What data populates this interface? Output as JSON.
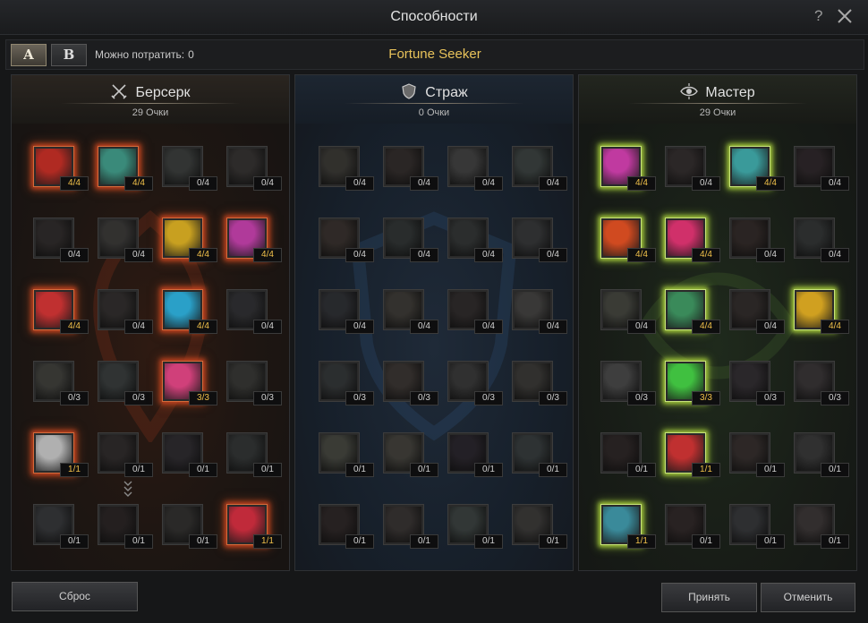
{
  "window": {
    "title": "Способности"
  },
  "toolbar": {
    "preset_a": "A",
    "preset_b": "B",
    "spend_label": "Можно потратить:",
    "spend_value": "0",
    "build_name": "Fortune Seeker"
  },
  "colors": {
    "gold": "#f0c04a",
    "red_glow": "#c0401e",
    "green_glow": "#a5c93c"
  },
  "columns": [
    {
      "name": "Берсерк",
      "icon": "crossed-swords-icon",
      "points": "29 Очки",
      "skills": [
        {
          "level": "4/4",
          "glow": "red",
          "hue": "#b02a22"
        },
        {
          "level": "4/4",
          "glow": "red",
          "hue": "#3a8a7a"
        },
        {
          "level": "0/4",
          "glow": "none",
          "hue": "#5a7a6a"
        },
        {
          "level": "0/4",
          "glow": "none",
          "hue": "#7a5a4a"
        },
        {
          "level": "0/4",
          "glow": "none",
          "hue": "#7a4a44"
        },
        {
          "level": "0/4",
          "glow": "none",
          "hue": "#7a6a5a"
        },
        {
          "level": "4/4",
          "glow": "red",
          "hue": "#c8a020"
        },
        {
          "level": "4/4",
          "glow": "red",
          "hue": "#b03a9a"
        },
        {
          "level": "4/4",
          "glow": "red",
          "hue": "#c03030"
        },
        {
          "level": "0/4",
          "glow": "none",
          "hue": "#7a5048"
        },
        {
          "level": "4/4",
          "glow": "red",
          "hue": "#2aa0c8"
        },
        {
          "level": "0/4",
          "glow": "none",
          "hue": "#5a5a7a"
        },
        {
          "level": "0/3",
          "glow": "none",
          "hue": "#7a7a4a"
        },
        {
          "level": "0/3",
          "glow": "none",
          "hue": "#4a7a7a"
        },
        {
          "level": "3/3",
          "glow": "red",
          "hue": "#d0407a"
        },
        {
          "level": "0/3",
          "glow": "none",
          "hue": "#6a6a4a"
        },
        {
          "level": "1/1",
          "glow": "red",
          "hue": "#b0b0b0"
        },
        {
          "level": "0/1",
          "glow": "none",
          "hue": "#7a4a4a"
        },
        {
          "level": "0/1",
          "glow": "none",
          "hue": "#6a4a7a"
        },
        {
          "level": "0/1",
          "glow": "none",
          "hue": "#4a6a6a"
        },
        {
          "level": "0/1",
          "glow": "none",
          "hue": "#5a6a8a"
        },
        {
          "level": "0/1",
          "glow": "none",
          "hue": "#7a3a3a"
        },
        {
          "level": "0/1",
          "glow": "none",
          "hue": "#6a5a4a"
        },
        {
          "level": "1/1",
          "glow": "red",
          "hue": "#c02a3a"
        }
      ]
    },
    {
      "name": "Страж",
      "icon": "shield-icon",
      "points": "0 Очки",
      "skills": [
        {
          "level": "0/4",
          "glow": "none",
          "hue": "#7a6a3a"
        },
        {
          "level": "0/4",
          "glow": "none",
          "hue": "#8a4a3a"
        },
        {
          "level": "0/4",
          "glow": "none",
          "hue": "#7a7a7a"
        },
        {
          "level": "0/4",
          "glow": "none",
          "hue": "#3a8a7a"
        },
        {
          "level": "0/4",
          "glow": "none",
          "hue": "#a0502a"
        },
        {
          "level": "0/4",
          "glow": "none",
          "hue": "#3a6a6a"
        },
        {
          "level": "0/4",
          "glow": "none",
          "hue": "#4a6a6a"
        },
        {
          "level": "0/4",
          "glow": "none",
          "hue": "#5a6a7a"
        },
        {
          "level": "0/4",
          "glow": "none",
          "hue": "#4a5a8a"
        },
        {
          "level": "0/4",
          "glow": "none",
          "hue": "#8a6a3a"
        },
        {
          "level": "0/4",
          "glow": "none",
          "hue": "#7a4a4a"
        },
        {
          "level": "0/4",
          "glow": "none",
          "hue": "#8a7a6a"
        },
        {
          "level": "0/3",
          "glow": "none",
          "hue": "#4a6a7a"
        },
        {
          "level": "0/3",
          "glow": "none",
          "hue": "#9a5a3a"
        },
        {
          "level": "0/3",
          "glow": "none",
          "hue": "#6a6a6a"
        },
        {
          "level": "0/3",
          "glow": "none",
          "hue": "#7a6a4a"
        },
        {
          "level": "0/1",
          "glow": "none",
          "hue": "#7a8a3a"
        },
        {
          "level": "0/1",
          "glow": "none",
          "hue": "#8a7a3a"
        },
        {
          "level": "0/1",
          "glow": "none",
          "hue": "#6a3a8a"
        },
        {
          "level": "0/1",
          "glow": "none",
          "hue": "#3a7a8a"
        },
        {
          "level": "0/1",
          "glow": "none",
          "hue": "#8a3a3a"
        },
        {
          "level": "0/1",
          "glow": "none",
          "hue": "#8a5a4a"
        },
        {
          "level": "0/1",
          "glow": "none",
          "hue": "#3a8a7a"
        },
        {
          "level": "0/1",
          "glow": "none",
          "hue": "#7a6a5a"
        }
      ]
    },
    {
      "name": "Мастер",
      "icon": "eye-icon",
      "points": "29 Очки",
      "skills": [
        {
          "level": "4/4",
          "glow": "green",
          "hue": "#c03aa0"
        },
        {
          "level": "0/4",
          "glow": "none",
          "hue": "#8a4a4a"
        },
        {
          "level": "4/4",
          "glow": "green",
          "hue": "#3a9a9a"
        },
        {
          "level": "0/4",
          "glow": "none",
          "hue": "#8a3a5a"
        },
        {
          "level": "4/4",
          "glow": "green",
          "hue": "#d04a20"
        },
        {
          "level": "4/4",
          "glow": "green",
          "hue": "#d0306a"
        },
        {
          "level": "0/4",
          "glow": "none",
          "hue": "#a0402a"
        },
        {
          "level": "0/4",
          "glow": "none",
          "hue": "#4a6a6a"
        },
        {
          "level": "0/4",
          "glow": "none",
          "hue": "#7a8a3a"
        },
        {
          "level": "4/4",
          "glow": "green",
          "hue": "#3a8a5a"
        },
        {
          "level": "0/4",
          "glow": "none",
          "hue": "#8a4a3a"
        },
        {
          "level": "4/4",
          "glow": "green",
          "hue": "#d0a020"
        },
        {
          "level": "0/3",
          "glow": "none",
          "hue": "#8a8a8a"
        },
        {
          "level": "3/3",
          "glow": "green",
          "hue": "#40c040"
        },
        {
          "level": "0/3",
          "glow": "none",
          "hue": "#7a4a7a"
        },
        {
          "level": "0/3",
          "glow": "none",
          "hue": "#8a5a6a"
        },
        {
          "level": "0/1",
          "glow": "none",
          "hue": "#8a3a3a"
        },
        {
          "level": "1/1",
          "glow": "green",
          "hue": "#c03030"
        },
        {
          "level": "0/1",
          "glow": "none",
          "hue": "#9a4a3a"
        },
        {
          "level": "0/1",
          "glow": "none",
          "hue": "#6a6a6a"
        },
        {
          "level": "1/1",
          "glow": "green",
          "hue": "#3a8a9a"
        },
        {
          "level": "0/1",
          "glow": "none",
          "hue": "#9a3a3a"
        },
        {
          "level": "0/1",
          "glow": "none",
          "hue": "#5a6a8a"
        },
        {
          "level": "0/1",
          "glow": "none",
          "hue": "#9a5a5a"
        }
      ]
    }
  ],
  "footer": {
    "reset": "Сброс",
    "accept": "Принять",
    "cancel": "Отменить"
  }
}
